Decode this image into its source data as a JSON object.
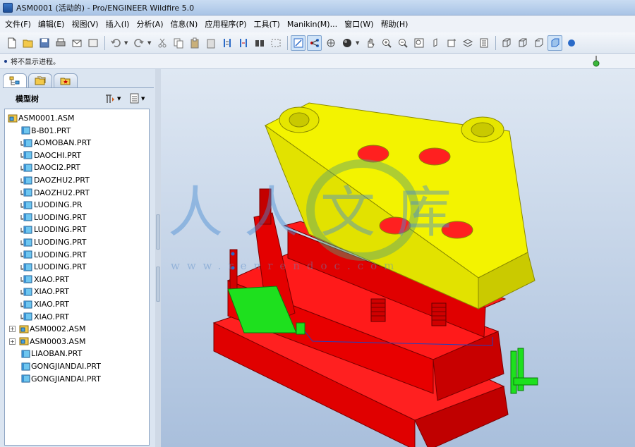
{
  "window": {
    "title": "ASM0001 (活动的) - Pro/ENGINEER Wildfire 5.0"
  },
  "menubar": {
    "items": [
      "文件(F)",
      "编辑(E)",
      "视图(V)",
      "插入(I)",
      "分析(A)",
      "信息(N)",
      "应用程序(P)",
      "工具(T)",
      "Manikin(M)...",
      "窗口(W)",
      "帮助(H)"
    ]
  },
  "toolbar": {
    "icons": [
      "new-file-icon",
      "open-folder-icon",
      "save-icon",
      "print-icon",
      "send-icon",
      "undo-icon",
      "redo-icon",
      "cut-icon",
      "copy-icon",
      "paste-icon",
      "regenerate-icon",
      "find-icon",
      "repaint-icon",
      "orient-icon",
      "zoom-in-icon",
      "zoom-out-icon",
      "refit-icon",
      "shading-icon",
      "view-manager-icon",
      "datum-plane-icon",
      "datum-axis-icon"
    ]
  },
  "status": {
    "message": "将不显示进程。"
  },
  "model_tree": {
    "title": "模型树",
    "tabs": [
      "model-tree-tab-icon",
      "folder-browser-tab-icon",
      "favorites-tab-icon"
    ],
    "items": [
      {
        "label": "ASM0001.ASM",
        "type": "asm",
        "level": 0
      },
      {
        "label": "B-B01.PRT",
        "type": "prt",
        "level": 1
      },
      {
        "label": "AOMOBAN.PRT",
        "type": "prt-arrow",
        "level": 1
      },
      {
        "label": "DAOCHI.PRT",
        "type": "prt-arrow",
        "level": 1
      },
      {
        "label": "DAOCI2.PRT",
        "type": "prt-arrow",
        "level": 1
      },
      {
        "label": "DAOZHU2.PRT",
        "type": "prt-arrow",
        "level": 1
      },
      {
        "label": "DAOZHU2.PRT",
        "type": "prt-arrow",
        "level": 1
      },
      {
        "label": "LUODING.PR",
        "type": "prt-arrow",
        "level": 1
      },
      {
        "label": "LUODING.PRT",
        "type": "prt-arrow",
        "level": 1
      },
      {
        "label": "LUODING.PRT",
        "type": "prt-arrow",
        "level": 1
      },
      {
        "label": "LUODING.PRT",
        "type": "prt-arrow",
        "level": 1
      },
      {
        "label": "LUODING.PRT",
        "type": "prt-arrow",
        "level": 1
      },
      {
        "label": "LUODING.PRT",
        "type": "prt-arrow",
        "level": 1
      },
      {
        "label": "XIAO.PRT",
        "type": "prt-arrow",
        "level": 1
      },
      {
        "label": "XIAO.PRT",
        "type": "prt-arrow",
        "level": 1
      },
      {
        "label": "XIAO.PRT",
        "type": "prt-arrow",
        "level": 1
      },
      {
        "label": "XIAO.PRT",
        "type": "prt-arrow",
        "level": 1
      },
      {
        "label": "ASM0002.ASM",
        "type": "asm",
        "level": 1,
        "expander": "+"
      },
      {
        "label": "ASM0003.ASM",
        "type": "asm",
        "level": 1,
        "expander": "+"
      },
      {
        "label": "LIAOBAN.PRT",
        "type": "prt",
        "level": 1
      },
      {
        "label": "GONGJIANDAI.PRT",
        "type": "prt",
        "level": 1
      },
      {
        "label": "GONGJIANDAI.PRT",
        "type": "prt",
        "level": 1
      }
    ]
  },
  "colors": {
    "yellow_part": "#f0f000",
    "red_part": "#ff0000",
    "green_part": "#1ee01e",
    "viewport_top": "#dfe8f3",
    "viewport_bottom": "#a9bfdc"
  },
  "watermark": {
    "text": "人人文库",
    "url": "www.renrendoc.com"
  }
}
